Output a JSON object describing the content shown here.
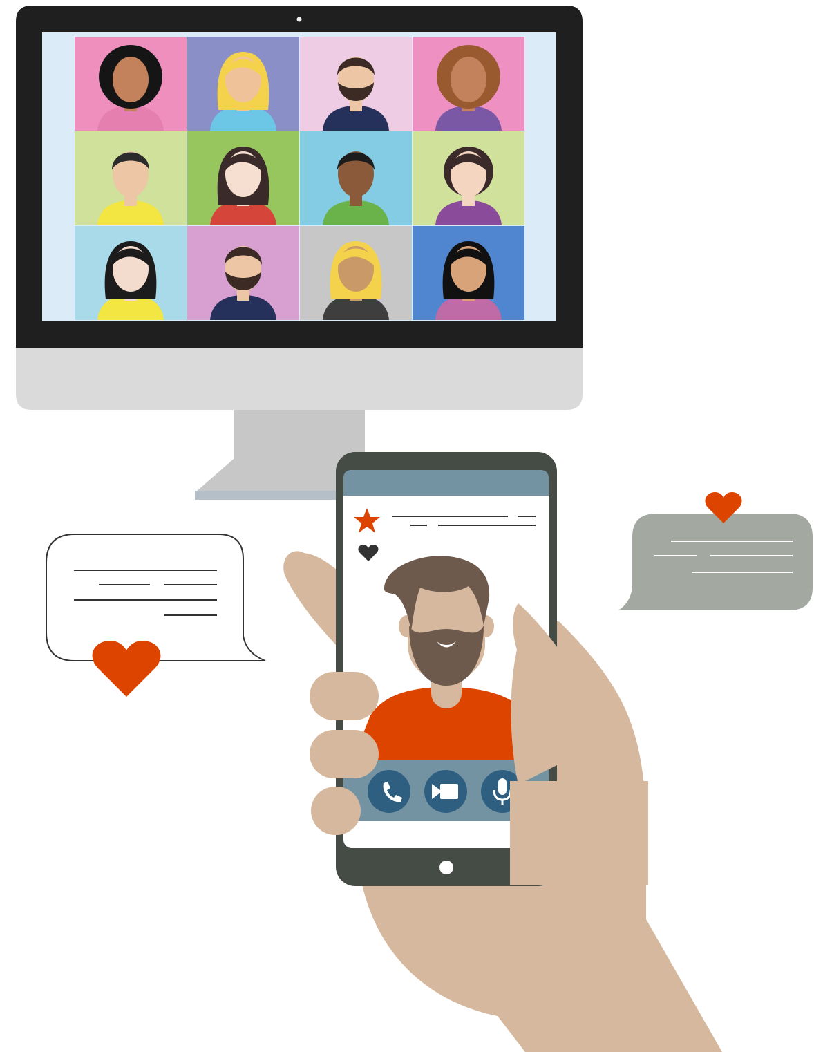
{
  "colors": {
    "monitor_frame": "#1f1f1f",
    "monitor_stand": "#dadada",
    "monitor_base": "#c7c7c7",
    "screen_backdrop": "#dcebf8",
    "phone_frame": "#454b45",
    "phone_header": "#7393a2",
    "phone_call_bar": "#7393a2",
    "call_button": "#2f5f80",
    "accent_red": "#dd4400",
    "heart_dark": "#333333",
    "skin_hand": "#d5b89d",
    "hair_brown": "#6e5a4d",
    "bubble_grey": "#a3a8a1",
    "bubble_outline": "#333333"
  },
  "video_grid": {
    "rows": 3,
    "cols": 4,
    "tiles": [
      {
        "bg": "#ee8fbe",
        "skin": "#c3825b",
        "hair": "#151515",
        "shirt": "#e57fb0",
        "style": "afro"
      },
      {
        "bg": "#8b8fc8",
        "skin": "#f0c29a",
        "hair": "#f4d24c",
        "shirt": "#6bc7e5",
        "style": "long"
      },
      {
        "bg": "#eecde4",
        "skin": "#edc7a5",
        "hair": "#3b2b24",
        "shirt": "#25305b",
        "style": "beard"
      },
      {
        "bg": "#ee90c1",
        "skin": "#c3825b",
        "hair": "#9a5a30",
        "shirt": "#7a58a6",
        "style": "afro"
      },
      {
        "bg": "#cfe19a",
        "skin": "#edc7a5",
        "hair": "#2b2b2b",
        "shirt": "#f4e642",
        "style": "short"
      },
      {
        "bg": "#97c65f",
        "skin": "#f6dfd0",
        "hair": "#3b2a2a",
        "shirt": "#d6453a",
        "style": "long"
      },
      {
        "bg": "#84cce3",
        "skin": "#8a5a3b",
        "hair": "#1c1c1c",
        "shirt": "#6ab24a",
        "style": "short"
      },
      {
        "bg": "#cfe19a",
        "skin": "#f3d5c0",
        "hair": "#3b2a2a",
        "shirt": "#8a4c9a",
        "style": "bun"
      },
      {
        "bg": "#a8daea",
        "skin": "#f3dccd",
        "hair": "#1c1c1c",
        "shirt": "#f4e642",
        "style": "long"
      },
      {
        "bg": "#d7a0d1",
        "skin": "#edc7a5",
        "hair": "#3b2b24",
        "shirt": "#25305b",
        "style": "beard"
      },
      {
        "bg": "#c7c7c7",
        "skin": "#c99a67",
        "hair": "#f4d24c",
        "shirt": "#3e3e3e",
        "style": "long"
      },
      {
        "bg": "#4f86cf",
        "skin": "#d9a37a",
        "hair": "#111111",
        "shirt": "#bf6ba8",
        "style": "long"
      }
    ]
  },
  "phone": {
    "call_buttons": [
      {
        "icon": "phone-icon"
      },
      {
        "icon": "video-camera-icon"
      },
      {
        "icon": "microphone-icon"
      }
    ]
  }
}
